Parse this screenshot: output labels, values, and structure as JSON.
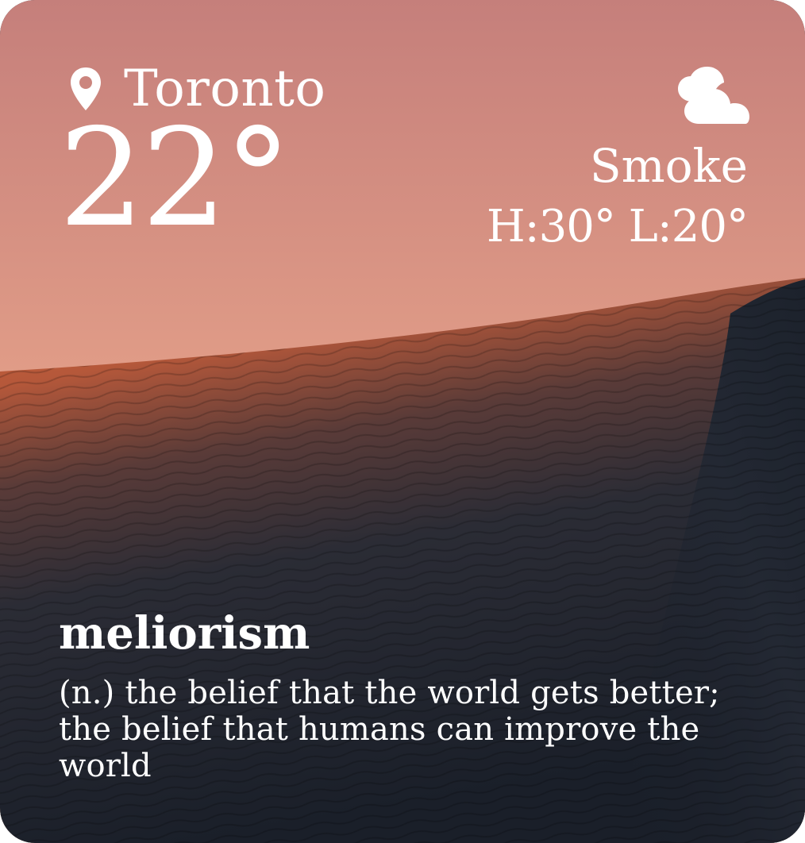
{
  "weather": {
    "city": "Toronto",
    "temperature": "22°",
    "condition": "Smoke",
    "hilo": "H:30° L:20°",
    "icons": {
      "location": "location-pin-icon",
      "condition": "cloud-icon"
    }
  },
  "word_of_day": {
    "word": "meliorism",
    "definition": "(n.) the belief that the world gets better; the belief that humans can improve the world"
  },
  "colors": {
    "sky_top": "#c57f7b",
    "sky_bottom": "#f0b89a",
    "dune_highlight": "#d9673d",
    "dune_shadow": "#1e2430",
    "text": "#ffffff"
  }
}
